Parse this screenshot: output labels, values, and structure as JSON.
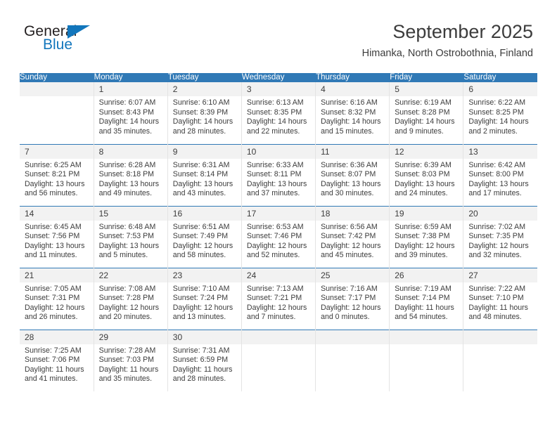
{
  "brand": {
    "name_part1": "General",
    "name_part2": "Blue",
    "accent_color": "#1276bc"
  },
  "header": {
    "title": "September 2025",
    "subtitle": "Himanka, North Ostrobothnia, Finland"
  },
  "calendar": {
    "header_color": "#3079b6",
    "weekday_headers": [
      "Sunday",
      "Monday",
      "Tuesday",
      "Wednesday",
      "Thursday",
      "Friday",
      "Saturday"
    ],
    "weeks": [
      [
        {
          "day": "",
          "blank": true,
          "sunrise": "",
          "sunset": "",
          "daylight_1": "",
          "daylight_2": ""
        },
        {
          "day": "1",
          "sunrise": "Sunrise: 6:07 AM",
          "sunset": "Sunset: 8:43 PM",
          "daylight_1": "Daylight: 14 hours",
          "daylight_2": "and 35 minutes."
        },
        {
          "day": "2",
          "sunrise": "Sunrise: 6:10 AM",
          "sunset": "Sunset: 8:39 PM",
          "daylight_1": "Daylight: 14 hours",
          "daylight_2": "and 28 minutes."
        },
        {
          "day": "3",
          "sunrise": "Sunrise: 6:13 AM",
          "sunset": "Sunset: 8:35 PM",
          "daylight_1": "Daylight: 14 hours",
          "daylight_2": "and 22 minutes."
        },
        {
          "day": "4",
          "sunrise": "Sunrise: 6:16 AM",
          "sunset": "Sunset: 8:32 PM",
          "daylight_1": "Daylight: 14 hours",
          "daylight_2": "and 15 minutes."
        },
        {
          "day": "5",
          "sunrise": "Sunrise: 6:19 AM",
          "sunset": "Sunset: 8:28 PM",
          "daylight_1": "Daylight: 14 hours",
          "daylight_2": "and 9 minutes."
        },
        {
          "day": "6",
          "sunrise": "Sunrise: 6:22 AM",
          "sunset": "Sunset: 8:25 PM",
          "daylight_1": "Daylight: 14 hours",
          "daylight_2": "and 2 minutes."
        }
      ],
      [
        {
          "day": "7",
          "sunrise": "Sunrise: 6:25 AM",
          "sunset": "Sunset: 8:21 PM",
          "daylight_1": "Daylight: 13 hours",
          "daylight_2": "and 56 minutes."
        },
        {
          "day": "8",
          "sunrise": "Sunrise: 6:28 AM",
          "sunset": "Sunset: 8:18 PM",
          "daylight_1": "Daylight: 13 hours",
          "daylight_2": "and 49 minutes."
        },
        {
          "day": "9",
          "sunrise": "Sunrise: 6:31 AM",
          "sunset": "Sunset: 8:14 PM",
          "daylight_1": "Daylight: 13 hours",
          "daylight_2": "and 43 minutes."
        },
        {
          "day": "10",
          "sunrise": "Sunrise: 6:33 AM",
          "sunset": "Sunset: 8:11 PM",
          "daylight_1": "Daylight: 13 hours",
          "daylight_2": "and 37 minutes."
        },
        {
          "day": "11",
          "sunrise": "Sunrise: 6:36 AM",
          "sunset": "Sunset: 8:07 PM",
          "daylight_1": "Daylight: 13 hours",
          "daylight_2": "and 30 minutes."
        },
        {
          "day": "12",
          "sunrise": "Sunrise: 6:39 AM",
          "sunset": "Sunset: 8:03 PM",
          "daylight_1": "Daylight: 13 hours",
          "daylight_2": "and 24 minutes."
        },
        {
          "day": "13",
          "sunrise": "Sunrise: 6:42 AM",
          "sunset": "Sunset: 8:00 PM",
          "daylight_1": "Daylight: 13 hours",
          "daylight_2": "and 17 minutes."
        }
      ],
      [
        {
          "day": "14",
          "sunrise": "Sunrise: 6:45 AM",
          "sunset": "Sunset: 7:56 PM",
          "daylight_1": "Daylight: 13 hours",
          "daylight_2": "and 11 minutes."
        },
        {
          "day": "15",
          "sunrise": "Sunrise: 6:48 AM",
          "sunset": "Sunset: 7:53 PM",
          "daylight_1": "Daylight: 13 hours",
          "daylight_2": "and 5 minutes."
        },
        {
          "day": "16",
          "sunrise": "Sunrise: 6:51 AM",
          "sunset": "Sunset: 7:49 PM",
          "daylight_1": "Daylight: 12 hours",
          "daylight_2": "and 58 minutes."
        },
        {
          "day": "17",
          "sunrise": "Sunrise: 6:53 AM",
          "sunset": "Sunset: 7:46 PM",
          "daylight_1": "Daylight: 12 hours",
          "daylight_2": "and 52 minutes."
        },
        {
          "day": "18",
          "sunrise": "Sunrise: 6:56 AM",
          "sunset": "Sunset: 7:42 PM",
          "daylight_1": "Daylight: 12 hours",
          "daylight_2": "and 45 minutes."
        },
        {
          "day": "19",
          "sunrise": "Sunrise: 6:59 AM",
          "sunset": "Sunset: 7:38 PM",
          "daylight_1": "Daylight: 12 hours",
          "daylight_2": "and 39 minutes."
        },
        {
          "day": "20",
          "sunrise": "Sunrise: 7:02 AM",
          "sunset": "Sunset: 7:35 PM",
          "daylight_1": "Daylight: 12 hours",
          "daylight_2": "and 32 minutes."
        }
      ],
      [
        {
          "day": "21",
          "sunrise": "Sunrise: 7:05 AM",
          "sunset": "Sunset: 7:31 PM",
          "daylight_1": "Daylight: 12 hours",
          "daylight_2": "and 26 minutes."
        },
        {
          "day": "22",
          "sunrise": "Sunrise: 7:08 AM",
          "sunset": "Sunset: 7:28 PM",
          "daylight_1": "Daylight: 12 hours",
          "daylight_2": "and 20 minutes."
        },
        {
          "day": "23",
          "sunrise": "Sunrise: 7:10 AM",
          "sunset": "Sunset: 7:24 PM",
          "daylight_1": "Daylight: 12 hours",
          "daylight_2": "and 13 minutes."
        },
        {
          "day": "24",
          "sunrise": "Sunrise: 7:13 AM",
          "sunset": "Sunset: 7:21 PM",
          "daylight_1": "Daylight: 12 hours",
          "daylight_2": "and 7 minutes."
        },
        {
          "day": "25",
          "sunrise": "Sunrise: 7:16 AM",
          "sunset": "Sunset: 7:17 PM",
          "daylight_1": "Daylight: 12 hours",
          "daylight_2": "and 0 minutes."
        },
        {
          "day": "26",
          "sunrise": "Sunrise: 7:19 AM",
          "sunset": "Sunset: 7:14 PM",
          "daylight_1": "Daylight: 11 hours",
          "daylight_2": "and 54 minutes."
        },
        {
          "day": "27",
          "sunrise": "Sunrise: 7:22 AM",
          "sunset": "Sunset: 7:10 PM",
          "daylight_1": "Daylight: 11 hours",
          "daylight_2": "and 48 minutes."
        }
      ],
      [
        {
          "day": "28",
          "sunrise": "Sunrise: 7:25 AM",
          "sunset": "Sunset: 7:06 PM",
          "daylight_1": "Daylight: 11 hours",
          "daylight_2": "and 41 minutes."
        },
        {
          "day": "29",
          "sunrise": "Sunrise: 7:28 AM",
          "sunset": "Sunset: 7:03 PM",
          "daylight_1": "Daylight: 11 hours",
          "daylight_2": "and 35 minutes."
        },
        {
          "day": "30",
          "sunrise": "Sunrise: 7:31 AM",
          "sunset": "Sunset: 6:59 PM",
          "daylight_1": "Daylight: 11 hours",
          "daylight_2": "and 28 minutes."
        },
        {
          "day": "",
          "blank": true,
          "sunrise": "",
          "sunset": "",
          "daylight_1": "",
          "daylight_2": ""
        },
        {
          "day": "",
          "blank": true,
          "sunrise": "",
          "sunset": "",
          "daylight_1": "",
          "daylight_2": ""
        },
        {
          "day": "",
          "blank": true,
          "sunrise": "",
          "sunset": "",
          "daylight_1": "",
          "daylight_2": ""
        },
        {
          "day": "",
          "blank": true,
          "sunrise": "",
          "sunset": "",
          "daylight_1": "",
          "daylight_2": ""
        }
      ]
    ]
  }
}
